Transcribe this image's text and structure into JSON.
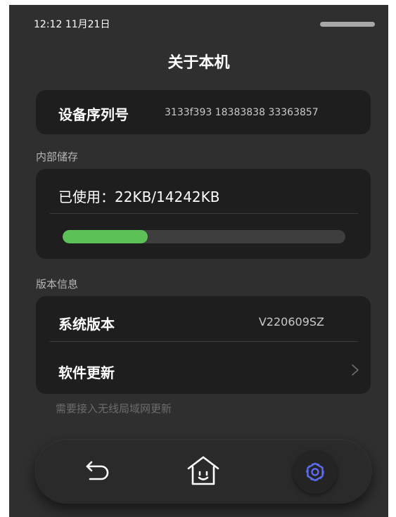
{
  "status_bar": {
    "time": "12:12",
    "date": "11月21日"
  },
  "header": {
    "title": "关于本机"
  },
  "device_info": {
    "serial_label": "设备序列号",
    "serial_value": "3133f393  18383838 33363857"
  },
  "storage": {
    "section_label": "内部储存",
    "usage_text": "已使用：22KB/14242KB",
    "progress_fraction": 0.3,
    "progress_color": "#5cc257"
  },
  "version": {
    "section_label": "版本信息",
    "system_version_label": "系统版本",
    "system_version_value": "V220609SZ",
    "software_update_label": "软件更新",
    "update_hint": "需要接入无线局域网更新"
  },
  "nav": {
    "back_icon": "back-arrow-icon",
    "home_icon": "home-icon",
    "settings_icon": "gear-icon",
    "settings_active_color": "#5b6cf2"
  }
}
